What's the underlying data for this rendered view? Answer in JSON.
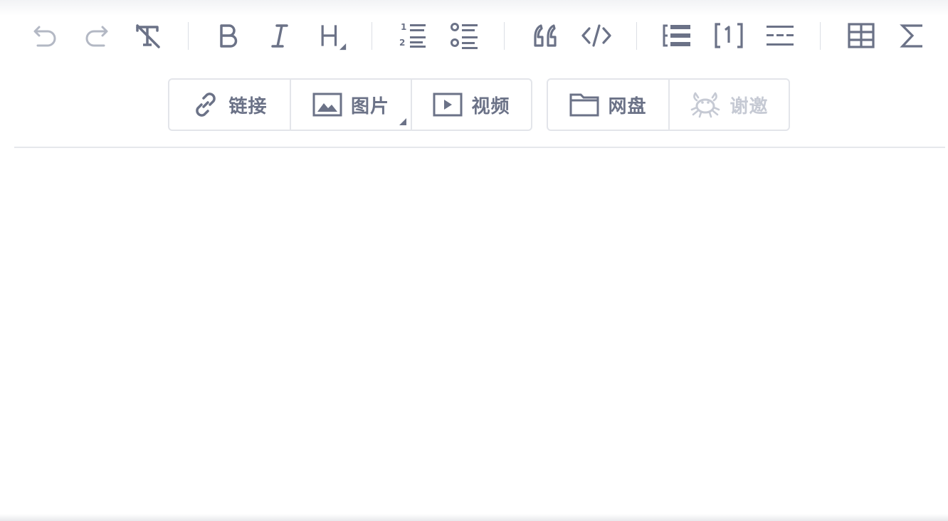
{
  "toolbar": {
    "buttons": [
      {
        "id": "undo",
        "icon": "undo-icon",
        "enabled": false
      },
      {
        "id": "redo",
        "icon": "redo-icon",
        "enabled": false
      },
      {
        "id": "clear-format",
        "icon": "clear-format-icon",
        "enabled": true
      },
      {
        "id": "bold",
        "icon": "bold-icon",
        "enabled": true
      },
      {
        "id": "italic",
        "icon": "italic-icon",
        "enabled": true
      },
      {
        "id": "heading",
        "icon": "heading-icon",
        "enabled": true
      },
      {
        "id": "ordered-list",
        "icon": "ordered-list-icon",
        "enabled": true
      },
      {
        "id": "unordered-list",
        "icon": "unordered-list-icon",
        "enabled": true
      },
      {
        "id": "blockquote",
        "icon": "quote-icon",
        "enabled": true
      },
      {
        "id": "code",
        "icon": "code-icon",
        "enabled": true
      },
      {
        "id": "toc",
        "icon": "toc-icon",
        "enabled": true
      },
      {
        "id": "footnote",
        "icon": "footnote-icon",
        "enabled": true
      },
      {
        "id": "horizontal-rule",
        "icon": "horizontal-rule-icon",
        "enabled": true
      },
      {
        "id": "table",
        "icon": "table-icon",
        "enabled": true
      },
      {
        "id": "formula",
        "icon": "sigma-icon",
        "enabled": true
      }
    ]
  },
  "media": {
    "link_label": "链接",
    "image_label": "图片",
    "video_label": "视频",
    "netdisk_label": "网盘",
    "thanks_label": "谢邀"
  },
  "colors": {
    "icon": "#6b7287",
    "icon_disabled": "#b3b8c4",
    "border": "#e3e5ea",
    "separator": "#dcdfe5"
  }
}
